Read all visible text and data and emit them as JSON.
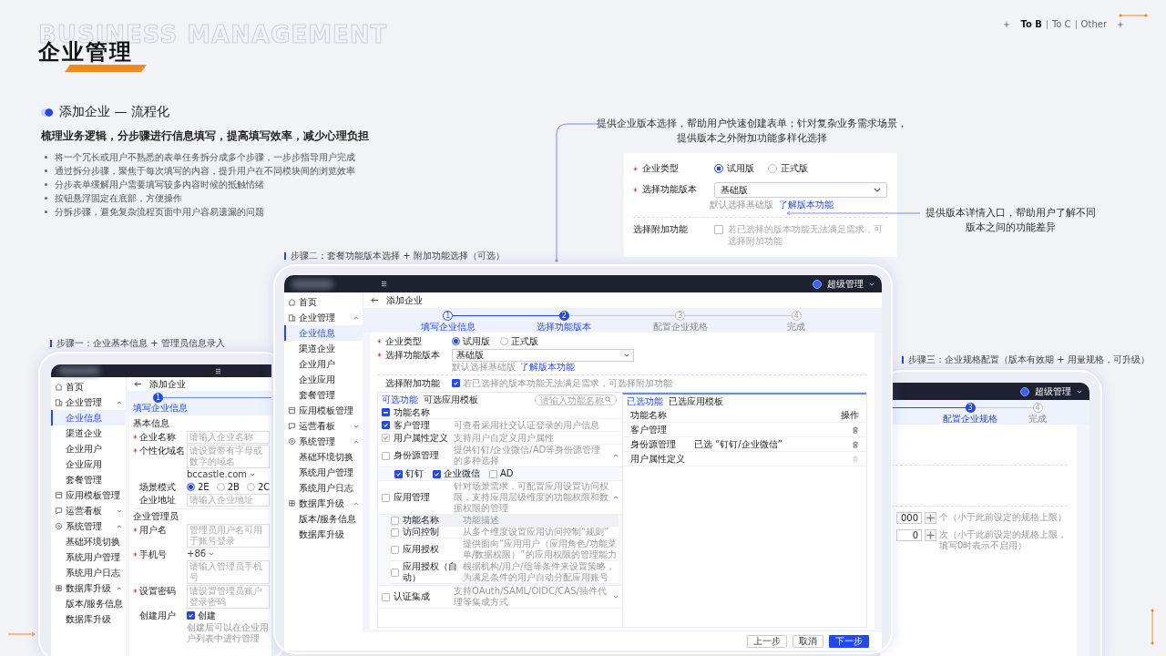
{
  "header": {
    "watermark_title": "BUSINESS MANAGEMENT",
    "title": "企业管理",
    "nav": [
      {
        "label": "To B",
        "selected": true
      },
      {
        "label": "To C",
        "selected": false
      },
      {
        "label": "Other",
        "selected": false
      }
    ]
  },
  "intro": {
    "heading": "添加企业 — 流程化",
    "summary": "梳理业务逻辑，分步骤进行信息填写，提高填写效率，减少心理负担",
    "points": [
      "将一个冗长或用户不熟悉的表单任务拆分成多个步骤，一步步指导用户完成",
      "通过拆分步骤，聚焦于每次填写的内容，提升用户在不同模块间的浏览效率",
      "分步表单缓解用户需要填写较多内容时候的抵触情绪",
      "按钮悬浮固定在底部，方便操作",
      "分拆步骤，避免复杂流程页面中用户容易遗漏的问题"
    ]
  },
  "version_note": {
    "lines": [
      "提供企业版本选择，帮助用户快速创建表单；针对复杂业务需求场景，",
      "提供版本之外附加功能多样化选择"
    ]
  },
  "detail_card": {
    "type_label": "企业类型",
    "type_required": true,
    "type_options": [
      {
        "label": "试用版",
        "selected": true
      },
      {
        "label": "正式版",
        "selected": false
      }
    ],
    "version_label": "选择功能版本",
    "version_required": true,
    "version_value": "基础版",
    "hint": "默认选择基础版",
    "link": "了解版本功能",
    "addon_label": "选择附加功能",
    "addon_checked": false,
    "addon_text": "若已选择的版本功能无法满足需求，可选择附加功能"
  },
  "link_note": {
    "lines": [
      "提供版本详情入口，帮助用户了解不同",
      "版本之间的功能差异"
    ]
  },
  "step_captions": [
    "步骤一：企业基本信息 + 管理员信息录入",
    "步骤二：套餐功能版本选择 + 附加功能选择（可选）",
    "步骤三：企业规格配置（版本有效期 + 用量规格，可升级）"
  ],
  "left_screen": {
    "sidebar": [
      {
        "label": "首页"
      },
      {
        "label": "企业管理",
        "expanded": true,
        "children": [
          {
            "label": "企业信息",
            "selected": true
          },
          {
            "label": "渠道企业",
            "selected": false
          },
          {
            "label": "企业用户",
            "selected": false
          },
          {
            "label": "企业应用",
            "selected": false
          },
          {
            "label": "套餐管理",
            "selected": false
          }
        ]
      },
      {
        "label": "应用模板管理"
      },
      {
        "label": "运营看板",
        "expanded": false
      },
      {
        "label": "系统管理",
        "expanded": true,
        "children": [
          {
            "label": "基础环境切换",
            "selected": false
          },
          {
            "label": "系统用户管理",
            "selected": false
          },
          {
            "label": "系统用户日志",
            "selected": false
          }
        ]
      },
      {
        "label": "数据库升级",
        "expanded": true,
        "children": [
          {
            "label": "版本/服务信息",
            "selected": false
          },
          {
            "label": "数据库升级",
            "selected": false
          }
        ]
      }
    ],
    "page_title": "添加企业",
    "step": {
      "number": "1",
      "label": "填写企业信息"
    },
    "sections": [
      {
        "title": "基本信息",
        "fields": [
          {
            "kind": "text",
            "label": "企业名称",
            "required": true,
            "placeholder": "请输入企业名称"
          },
          {
            "kind": "domain",
            "label": "个性化域名",
            "required": true,
            "placeholder": "请设置带有字母或数字的域名",
            "suffix": "bccastle.com"
          },
          {
            "kind": "radio",
            "label": "场景模式",
            "required": false,
            "options": [
              {
                "label": "2E",
                "selected": true
              },
              {
                "label": "2B",
                "selected": false
              },
              {
                "label": "2C",
                "selected": false
              }
            ]
          },
          {
            "kind": "text",
            "label": "企业地址",
            "required": false,
            "placeholder": "请输入企业地址"
          }
        ]
      },
      {
        "title": "企业管理员",
        "fields": [
          {
            "kind": "text",
            "label": "用户名",
            "required": true,
            "placeholder": "管理员用户名可用于账号登录"
          },
          {
            "kind": "phone",
            "label": "手机号",
            "required": true,
            "prefix": "+86",
            "placeholder": "请输入管理员手机号"
          },
          {
            "kind": "text",
            "label": "设置密码",
            "required": true,
            "placeholder": "请设置管理员账户登录密码"
          },
          {
            "kind": "checkbox",
            "label": "创建用户",
            "required": false,
            "checked": true,
            "option": "创建",
            "note": "创建后可以在企业用户列表中进行管理"
          }
        ]
      }
    ]
  },
  "center_screen": {
    "user": "超级管理",
    "sidebar": [
      {
        "label": "首页"
      },
      {
        "label": "企业管理",
        "expanded": true,
        "children": [
          {
            "label": "企业信息",
            "selected": true
          },
          {
            "label": "渠道企业",
            "selected": false
          },
          {
            "label": "企业用户",
            "selected": false
          },
          {
            "label": "企业应用",
            "selected": false
          },
          {
            "label": "套餐管理",
            "selected": false
          }
        ]
      },
      {
        "label": "应用模板管理"
      },
      {
        "label": "运营看板",
        "expanded": false
      },
      {
        "label": "系统管理",
        "expanded": true,
        "children": [
          {
            "label": "基础环境切换",
            "selected": false
          },
          {
            "label": "系统用户管理",
            "selected": false
          },
          {
            "label": "系统用户日志",
            "selected": false
          }
        ]
      },
      {
        "label": "数据库升级",
        "expanded": true,
        "children": [
          {
            "label": "版本/服务信息",
            "selected": false
          },
          {
            "label": "数据库升级",
            "selected": false
          }
        ]
      }
    ],
    "page_title": "添加企业",
    "steps": [
      {
        "number": "1",
        "label": "填写企业信息",
        "selected": false
      },
      {
        "number": "2",
        "label": "选择功能版本",
        "selected": true
      },
      {
        "number": "3",
        "label": "配置企业规格",
        "selected": false
      },
      {
        "number": "4",
        "label": "完成",
        "selected": false
      }
    ],
    "form": {
      "type_label": "企业类型",
      "type_required": true,
      "type_options": [
        {
          "label": "试用版",
          "selected": true
        },
        {
          "label": "正式版",
          "selected": false
        }
      ],
      "version_label": "选择功能版本",
      "version_required": true,
      "version_value": "基础版",
      "hint": "默认选择基础版",
      "link": "了解版本功能",
      "addon_label": "选择附加功能",
      "addon_checked": true,
      "addon_text": "若已选择的版本功能无法满足需求，可选择附加功能"
    },
    "available": {
      "tabs": [
        {
          "label": "可选功能",
          "selected": true
        },
        {
          "label": "可选应用模板",
          "selected": false
        }
      ],
      "search_placeholder": "请输入功能名称",
      "header": {
        "label": "功能名称",
        "indeterminate": true
      },
      "rows": [
        {
          "kind": "plain",
          "name": "客户管理",
          "description": "可查看采用社交认证登录的用户信息",
          "checked": true,
          "disabled": false
        },
        {
          "kind": "plain",
          "name": "用户属性定义",
          "description": "支持用户自定义用户属性",
          "checked": true,
          "disabled": true
        },
        {
          "kind": "options",
          "name": "身份源管理",
          "description": "提供钉钉/企业微信/AD等身份源管理的多种选择",
          "checked": false,
          "disabled": false,
          "expanded": true,
          "options": [
            {
              "label": "钉钉",
              "checked": true
            },
            {
              "label": "企业微信",
              "checked": true
            },
            {
              "label": "AD",
              "checked": false
            }
          ]
        },
        {
          "kind": "table",
          "name": "应用管理",
          "description": "针对场景需求，可配置应用设置访问权限，支持应用层级维度的功能权限和数据权限的管理",
          "checked": false,
          "disabled": false,
          "expanded": true,
          "header_checked": false,
          "columns": [
            "功能名称",
            "功能描述"
          ],
          "subrows": [
            {
              "name": "访问控制",
              "description": "从多个维度设置应用访问控制“规则”",
              "checked": false
            },
            {
              "name": "应用授权",
              "description": "提供面向“应用用户（应用角色/功能菜单/数据权限）”的应用权限的管理能力",
              "checked": false
            },
            {
              "name": "应用授权（自动）",
              "description": "根据机构/用户/组等条件来设置策略，为满足条件的用户自动分配应用账号",
              "checked": false
            }
          ]
        },
        {
          "kind": "plain",
          "name": "认证集成",
          "description": "支持OAuth/SAML/OIDC/CAS/插件代理等集成方式",
          "checked": false,
          "disabled": false,
          "expanded": false
        }
      ]
    },
    "chosen": {
      "tabs": [
        {
          "label": "已选功能",
          "selected": true
        },
        {
          "label": "已选应用模板",
          "selected": false
        }
      ],
      "columns": [
        "功能名称",
        "操作"
      ],
      "rows": [
        {
          "name": "客户管理",
          "removable": true
        },
        {
          "name": "身份源管理",
          "note": "已选 “钉钉/企业微信”",
          "removable": true
        },
        {
          "name": "用户属性定义",
          "removable": false
        }
      ]
    },
    "buttons": [
      {
        "label": "上一步",
        "kind": "default"
      },
      {
        "label": "取消",
        "kind": "default"
      },
      {
        "label": "下一步",
        "kind": "primary"
      }
    ]
  },
  "right_screen": {
    "user": "超级管理",
    "steps": [
      {
        "number": "3",
        "label": "配置企业规格",
        "selected": true
      },
      {
        "number": "4",
        "label": "完成",
        "selected": false
      }
    ],
    "quotas": [
      {
        "value": "000",
        "note": "个（小于此前设定的规格上限）"
      },
      {
        "value": "0",
        "note": "次（小于此前设定的规格上限，填写0时表示不启用）"
      }
    ]
  }
}
